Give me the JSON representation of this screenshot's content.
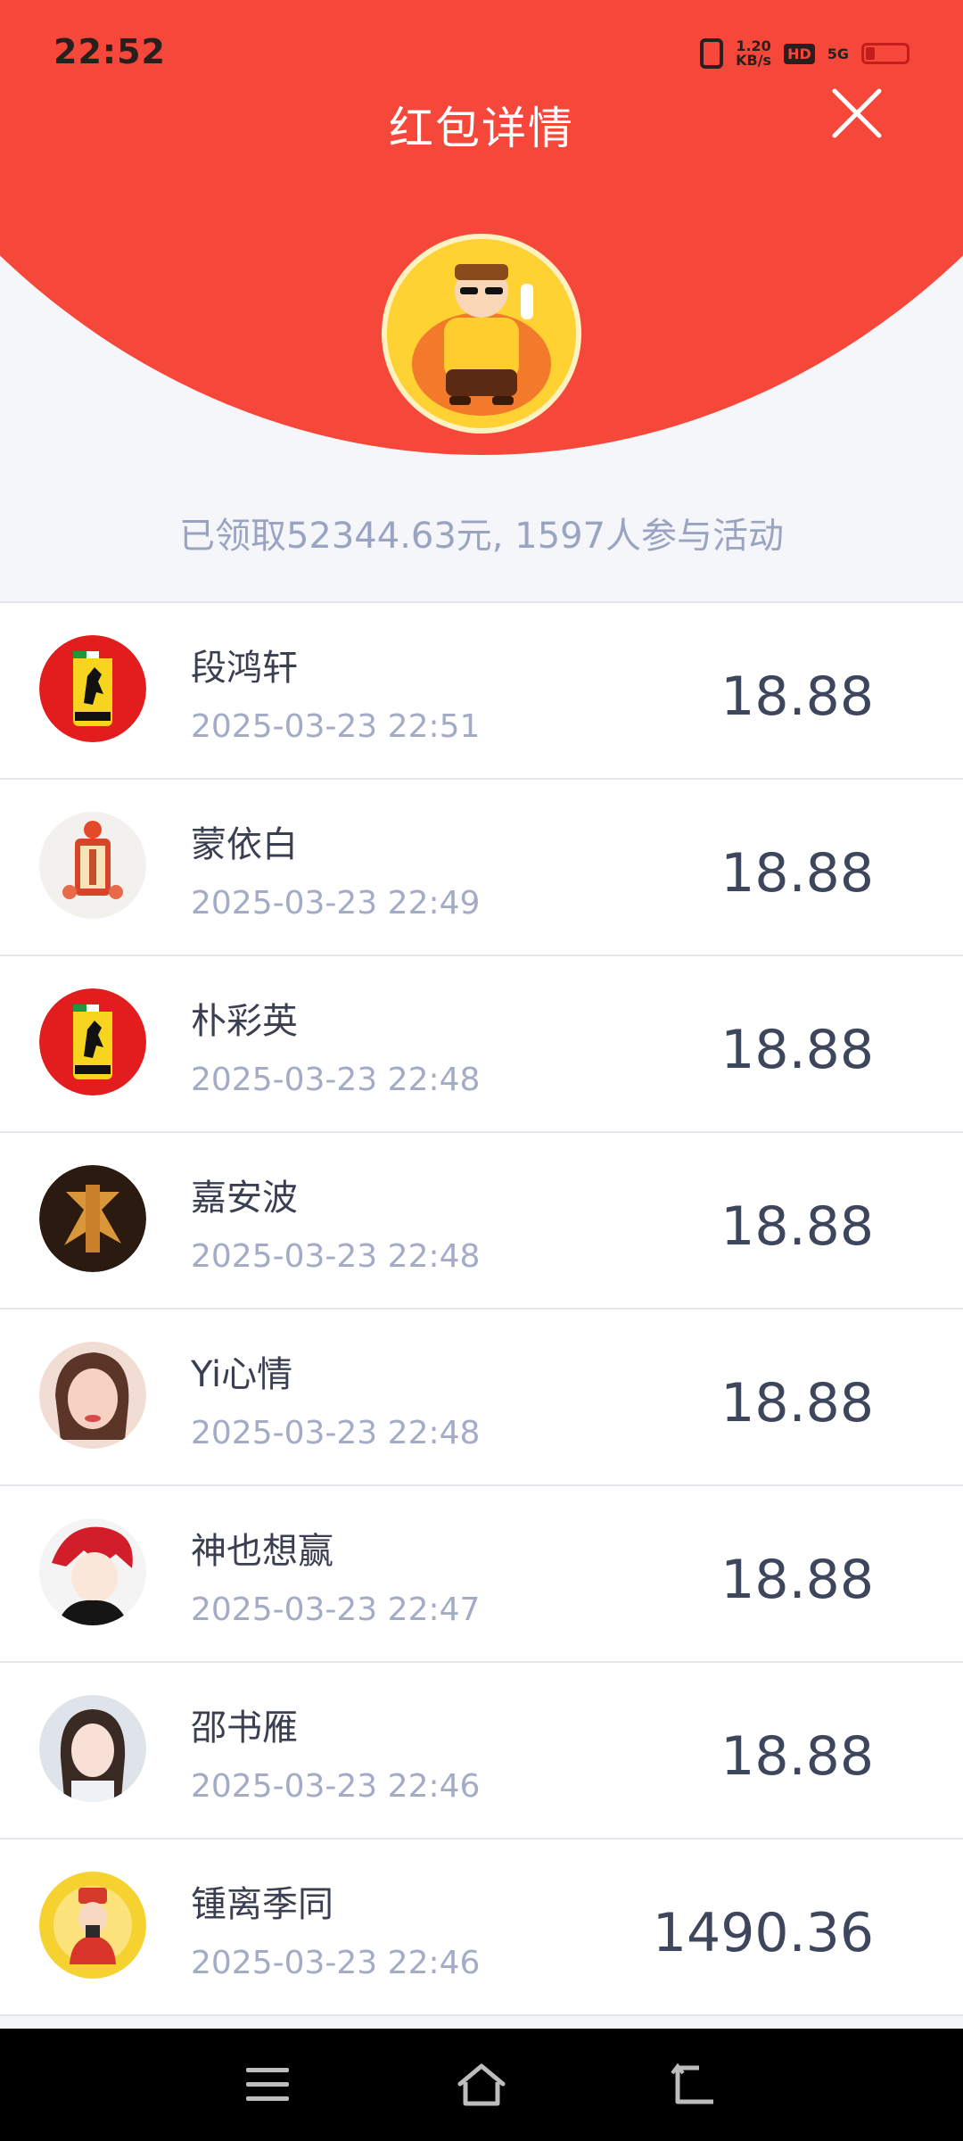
{
  "status_bar": {
    "time": "22:52",
    "network_speed_value": "1.20",
    "network_speed_unit": "KB/s",
    "hd": "HD",
    "signal": "5G"
  },
  "header": {
    "title": "红包详情"
  },
  "summary": "已领取52344.63元, 1597人参与活动",
  "records": [
    {
      "name": "段鸿轩",
      "time": "2025-03-23 22:51",
      "amount": "18.88",
      "avatar_icon": "ferrari-logo"
    },
    {
      "name": "蒙依白",
      "time": "2025-03-23 22:49",
      "amount": "18.88",
      "avatar_icon": "lantern-decoration"
    },
    {
      "name": "朴彩英",
      "time": "2025-03-23 22:48",
      "amount": "18.88",
      "avatar_icon": "ferrari-logo"
    },
    {
      "name": "嘉安波",
      "time": "2025-03-23 22:48",
      "amount": "18.88",
      "avatar_icon": "fa-character"
    },
    {
      "name": "Yi心情",
      "time": "2025-03-23 22:48",
      "amount": "18.88",
      "avatar_icon": "woman-portrait"
    },
    {
      "name": "神也想赢",
      "time": "2025-03-23 22:47",
      "amount": "18.88",
      "avatar_icon": "anime-character"
    },
    {
      "name": "邵书雁",
      "time": "2025-03-23 22:46",
      "amount": "18.88",
      "avatar_icon": "woman-portrait"
    },
    {
      "name": "锺离季同",
      "time": "2025-03-23 22:46",
      "amount": "1490.36",
      "avatar_icon": "god-of-wealth"
    }
  ],
  "colors": {
    "header_red": "#f5473a",
    "amount_text": "#3e465d",
    "summary_text": "#9aa4c2"
  }
}
